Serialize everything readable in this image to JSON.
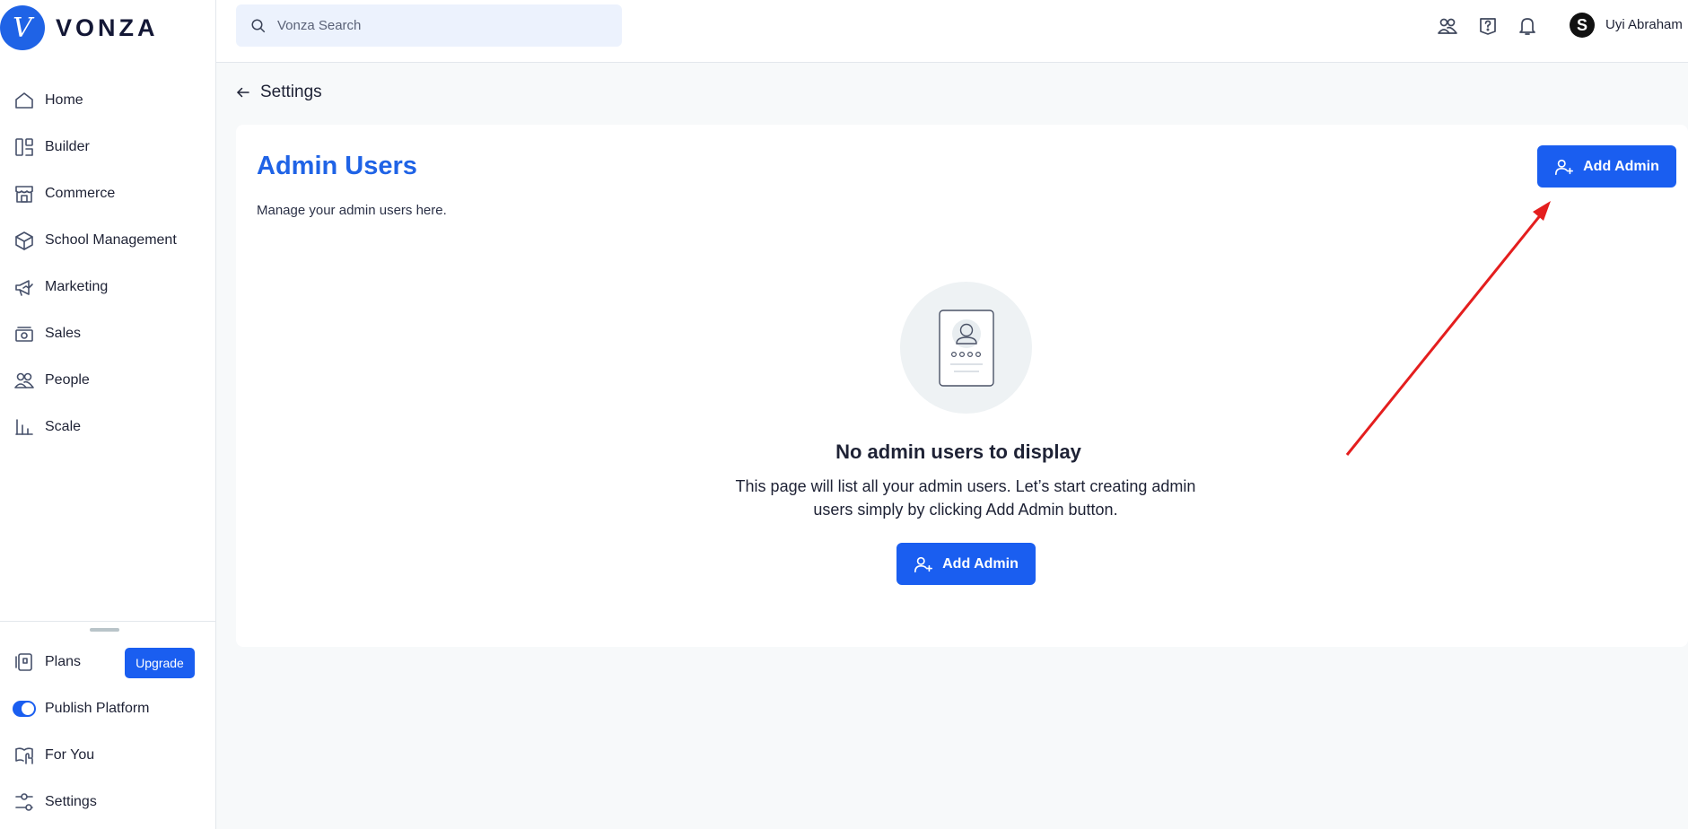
{
  "brand": {
    "name": "VONZA",
    "mark": "V"
  },
  "sidebar": {
    "items": [
      {
        "label": "Home",
        "icon": "home-icon"
      },
      {
        "label": "Builder",
        "icon": "builder-icon"
      },
      {
        "label": "Commerce",
        "icon": "store-icon"
      },
      {
        "label": "School Management",
        "icon": "school-icon"
      },
      {
        "label": "Marketing",
        "icon": "megaphone-icon"
      },
      {
        "label": "Sales",
        "icon": "cash-icon"
      },
      {
        "label": "People",
        "icon": "people-icon"
      },
      {
        "label": "Scale",
        "icon": "bar-chart-icon"
      }
    ],
    "bottom": {
      "plans": "Plans",
      "upgrade": "Upgrade",
      "publish": "Publish Platform",
      "for_you": "For You",
      "settings": "Settings"
    }
  },
  "header": {
    "search_placeholder": "Vonza Search",
    "avatar_initial": "S",
    "user_name": "Uyi Abraham"
  },
  "page": {
    "back_label": "Settings",
    "title": "Admin Users",
    "subtitle": "Manage your admin users here.",
    "add_admin_label": "Add Admin",
    "empty_title": "No admin users to display",
    "empty_description": "This page will list all your admin users. Let’s start creating admin users simply by clicking Add Admin button."
  },
  "colors": {
    "accent": "#1a5ef0",
    "title_blue": "#1f63e6",
    "annotation": "#e41e1e"
  }
}
